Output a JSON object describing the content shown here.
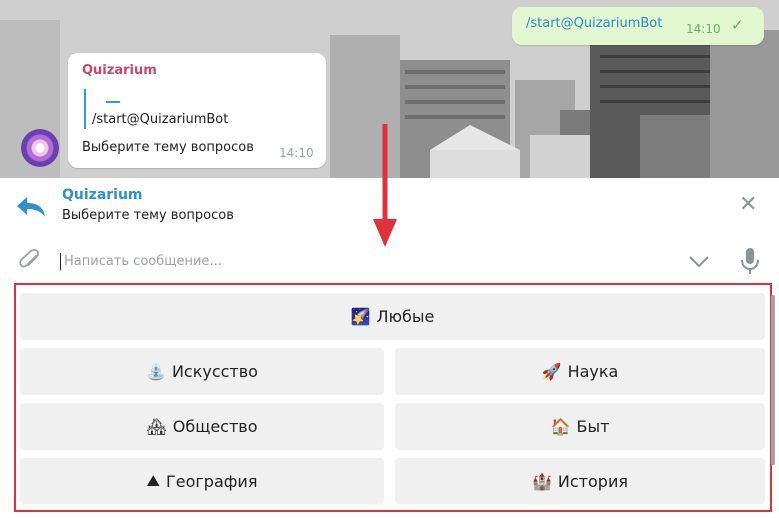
{
  "chat": {
    "outgoing": {
      "text": "/start@QuizariumBot",
      "time": "14:10",
      "status_icon": "double-check-icon"
    },
    "incoming": {
      "sender": "Quizarium",
      "quoted_text": "/start@QuizariumBot",
      "text": "Выберите тему вопросов",
      "time": "14:10"
    }
  },
  "reply": {
    "name": "Quizarium",
    "text": "Выберите тему вопросов",
    "close_glyph": "✕"
  },
  "composer": {
    "placeholder": "Написать сообщение...",
    "value": ""
  },
  "keyboard": {
    "buttons": [
      {
        "label": "Любые",
        "emoji": "🌠"
      },
      {
        "label": "Искусство",
        "emoji": "⛲"
      },
      {
        "label": "Наука",
        "emoji": "🚀"
      },
      {
        "label": "Общество",
        "emoji": "🏘"
      },
      {
        "label": "Быт",
        "emoji": "🏠"
      },
      {
        "label": "География",
        "emoji": "⛰"
      },
      {
        "label": "История",
        "emoji": "🏰"
      }
    ]
  },
  "colors": {
    "accent": "#2f8fcf",
    "sender": "#c8466c",
    "highlight": "#e0303a",
    "outgoing_bubble": "#e2f7cf"
  }
}
